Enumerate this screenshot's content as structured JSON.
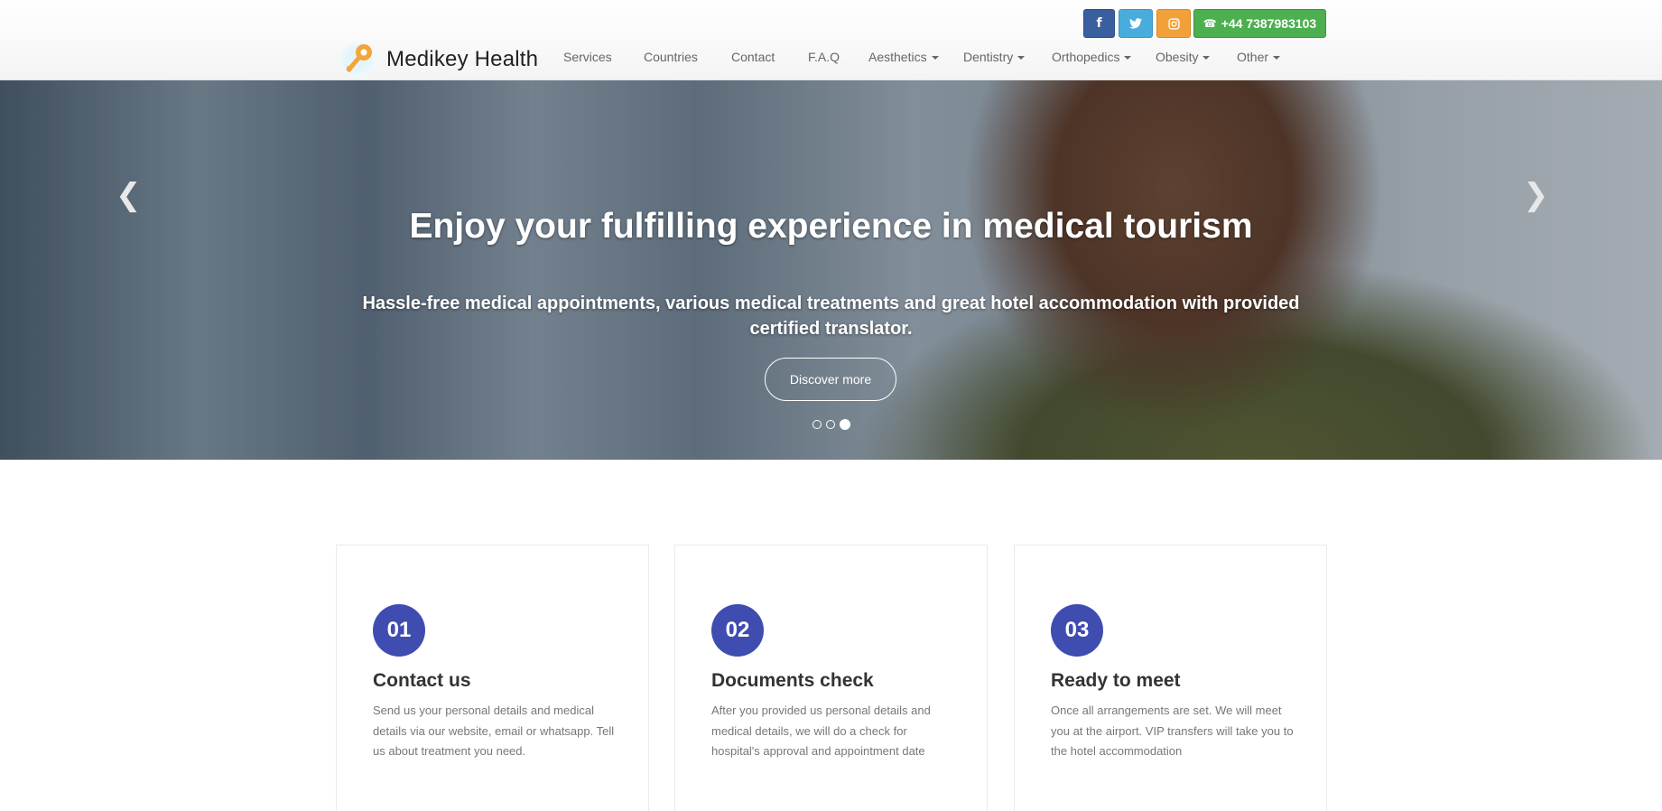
{
  "brand": {
    "name": "Medikey Health"
  },
  "nav": {
    "items": [
      {
        "label": "Services",
        "dropdown": false
      },
      {
        "label": "Countries",
        "dropdown": false
      },
      {
        "label": "Contact",
        "dropdown": false
      },
      {
        "label": "F.A.Q",
        "dropdown": false
      },
      {
        "label": "Aesthetics",
        "dropdown": true
      },
      {
        "label": "Dentistry",
        "dropdown": true
      },
      {
        "label": "Orthopedics",
        "dropdown": true
      },
      {
        "label": "Obesity",
        "dropdown": true
      },
      {
        "label": "Other",
        "dropdown": true
      }
    ]
  },
  "social": {
    "facebook_icon": "f",
    "twitter_icon": "twitter-icon",
    "instagram_icon": "instagram-icon",
    "phone": "+44 7387983103"
  },
  "hero": {
    "title": "Enjoy your fulfilling experience in medical tourism",
    "subtitle": "Hassle-free medical appointments, various medical treatments and great hotel accommodation with provided certified translator.",
    "cta": "Discover more",
    "slides": 3,
    "active_slide": 3
  },
  "steps": [
    {
      "number": "01",
      "title": "Contact us",
      "text": "Send us your personal details and medical details via our website, email or whatsapp. Tell us about treatment you need."
    },
    {
      "number": "02",
      "title": "Documents check",
      "text": "After you provided us personal details and medical details, we will do a check for hospital's approval and appointment date"
    },
    {
      "number": "03",
      "title": "Ready to meet",
      "text": "Once all arrangements are set. We will meet you at the airport. VIP transfers will take you to the hotel accommodation"
    }
  ],
  "colors": {
    "accent": "#3f4db1",
    "facebook": "#3a5f9e",
    "twitter": "#49acdd",
    "instagram": "#f1a03a",
    "phone": "#4caf50"
  }
}
